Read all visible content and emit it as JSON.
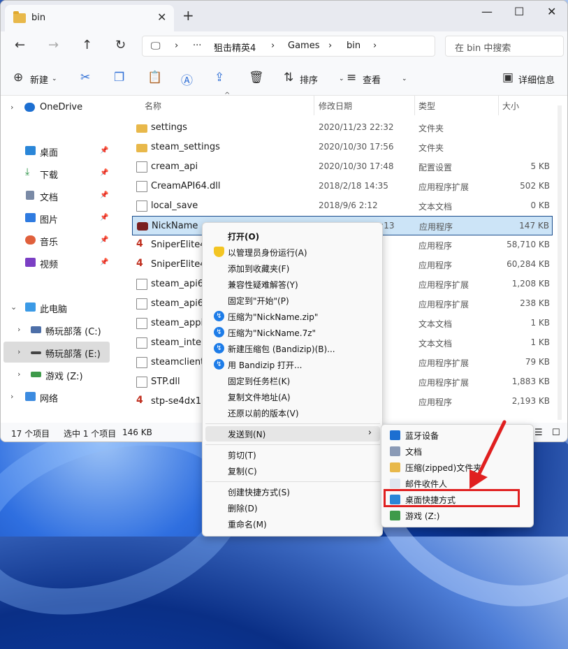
{
  "window": {
    "tab_title": "bin",
    "new_tab": "+",
    "min": "—",
    "max": "☐",
    "close": "✕",
    "tab_close": "✕"
  },
  "address": {
    "more": "···",
    "crumbs": [
      "狙击精英4",
      "Games",
      "bin"
    ],
    "sep": "›",
    "search_placeholder": "在 bin 中搜索"
  },
  "toolbar": {
    "new": "新建",
    "sort": "排序",
    "view": "查看",
    "details": "详细信息",
    "more": "···"
  },
  "sidebar": [
    {
      "label": "OneDrive",
      "pinned": false,
      "chev": "›"
    },
    {
      "label": "桌面",
      "pinned": true
    },
    {
      "label": "下载",
      "pinned": true
    },
    {
      "label": "文档",
      "pinned": true
    },
    {
      "label": "图片",
      "pinned": true
    },
    {
      "label": "音乐",
      "pinned": true
    },
    {
      "label": "视频",
      "pinned": true
    },
    {
      "label": "此电脑",
      "pinned": false,
      "chev": "⌄"
    },
    {
      "label": "畅玩部落 (C:)",
      "pinned": false,
      "chev": "›"
    },
    {
      "label": "畅玩部落 (E:)",
      "pinned": false,
      "chev": "›"
    },
    {
      "label": "游戏 (Z:)",
      "pinned": false,
      "chev": "›"
    },
    {
      "label": "网络",
      "pinned": false,
      "chev": "›"
    }
  ],
  "columns": {
    "name": "名称",
    "date": "修改日期",
    "type": "类型",
    "size": "大小"
  },
  "files": [
    {
      "name": "settings",
      "date": "2020/11/23 22:32",
      "type": "文件夹",
      "size": "",
      "icon": "folder"
    },
    {
      "name": "steam_settings",
      "date": "2020/10/30 17:56",
      "type": "文件夹",
      "size": "",
      "icon": "folder"
    },
    {
      "name": "cream_api",
      "date": "2020/10/30 17:48",
      "type": "配置设置",
      "size": "5 KB",
      "icon": "doc"
    },
    {
      "name": "CreamAPI64.dll",
      "date": "2018/2/18 14:35",
      "type": "应用程序扩展",
      "size": "502 KB",
      "icon": "doc"
    },
    {
      "name": "local_save",
      "date": "2018/9/6 2:12",
      "type": "文本文档",
      "size": "0 KB",
      "icon": "doc"
    },
    {
      "name": "NickName",
      "date": "2018/10/14 21:13",
      "type": "应用程序",
      "size": "147 KB",
      "icon": "exe"
    },
    {
      "name": "SniperElite4_",
      "date": "",
      "type": "应用程序",
      "size": "58,710 KB",
      "icon": "app"
    },
    {
      "name": "SniperElite4_",
      "date": "",
      "type": "应用程序",
      "size": "60,284 KB",
      "icon": "app"
    },
    {
      "name": "steam_api64_",
      "date": "",
      "type": "应用程序扩展",
      "size": "1,208 KB",
      "icon": "doc"
    },
    {
      "name": "steam_api64_",
      "date": "",
      "type": "应用程序扩展",
      "size": "238 KB",
      "icon": "doc"
    },
    {
      "name": "steam_appid",
      "date": "",
      "type": "文本文档",
      "size": "1 KB",
      "icon": "doc"
    },
    {
      "name": "steam_interfa",
      "date": "",
      "type": "文本文档",
      "size": "1 KB",
      "icon": "doc"
    },
    {
      "name": "steamclient64",
      "date": "",
      "type": "应用程序扩展",
      "size": "79 KB",
      "icon": "doc"
    },
    {
      "name": "STP.dll",
      "date": "",
      "type": "应用程序扩展",
      "size": "1,883 KB",
      "icon": "doc"
    },
    {
      "name": "stp-se4dx11",
      "date": "",
      "type": "应用程序",
      "size": "2,193 KB",
      "icon": "app"
    }
  ],
  "status": {
    "count": "17 个项目",
    "selected": "选中 1 个项目",
    "size": "146 KB"
  },
  "menu": [
    {
      "label": "打开(O)",
      "bold": true,
      "icon": ""
    },
    {
      "label": "以管理员身份运行(A)",
      "icon": "shield"
    },
    {
      "label": "添加到收藏夹(F)",
      "icon": ""
    },
    {
      "label": "兼容性疑难解答(Y)",
      "icon": ""
    },
    {
      "label": "固定到\"开始\"(P)",
      "icon": ""
    },
    {
      "label": "压缩为\"NickName.zip\"",
      "icon": "bz"
    },
    {
      "label": "压缩为\"NickName.7z\"",
      "icon": "bz"
    },
    {
      "label": "新建压缩包 (Bandizip)(B)...",
      "icon": "bz"
    },
    {
      "label": "用 Bandizip 打开...",
      "icon": "bz"
    },
    {
      "label": "固定到任务栏(K)",
      "icon": ""
    },
    {
      "label": "复制文件地址(A)",
      "icon": ""
    },
    {
      "label": "还原以前的版本(V)",
      "icon": ""
    },
    {
      "label": "发送到(N)",
      "icon": "",
      "arrow": "›"
    },
    {
      "label": "剪切(T)",
      "icon": ""
    },
    {
      "label": "复制(C)",
      "icon": ""
    },
    {
      "label": "创建快捷方式(S)",
      "icon": ""
    },
    {
      "label": "删除(D)",
      "icon": ""
    },
    {
      "label": "重命名(M)",
      "icon": ""
    }
  ],
  "submenu": [
    {
      "label": "蓝牙设备",
      "icon": "bluetooth"
    },
    {
      "label": "文档",
      "icon": "doc"
    },
    {
      "label": "压缩(zipped)文件夹",
      "icon": "zip"
    },
    {
      "label": "邮件收件人",
      "icon": "mail"
    },
    {
      "label": "桌面快捷方式",
      "icon": "desktop"
    },
    {
      "label": "游戏 (Z:)",
      "icon": "drive"
    }
  ],
  "colors": {
    "accent": "#1a4d8c",
    "highlight": "#e02020",
    "selection": "#cce4f7"
  }
}
